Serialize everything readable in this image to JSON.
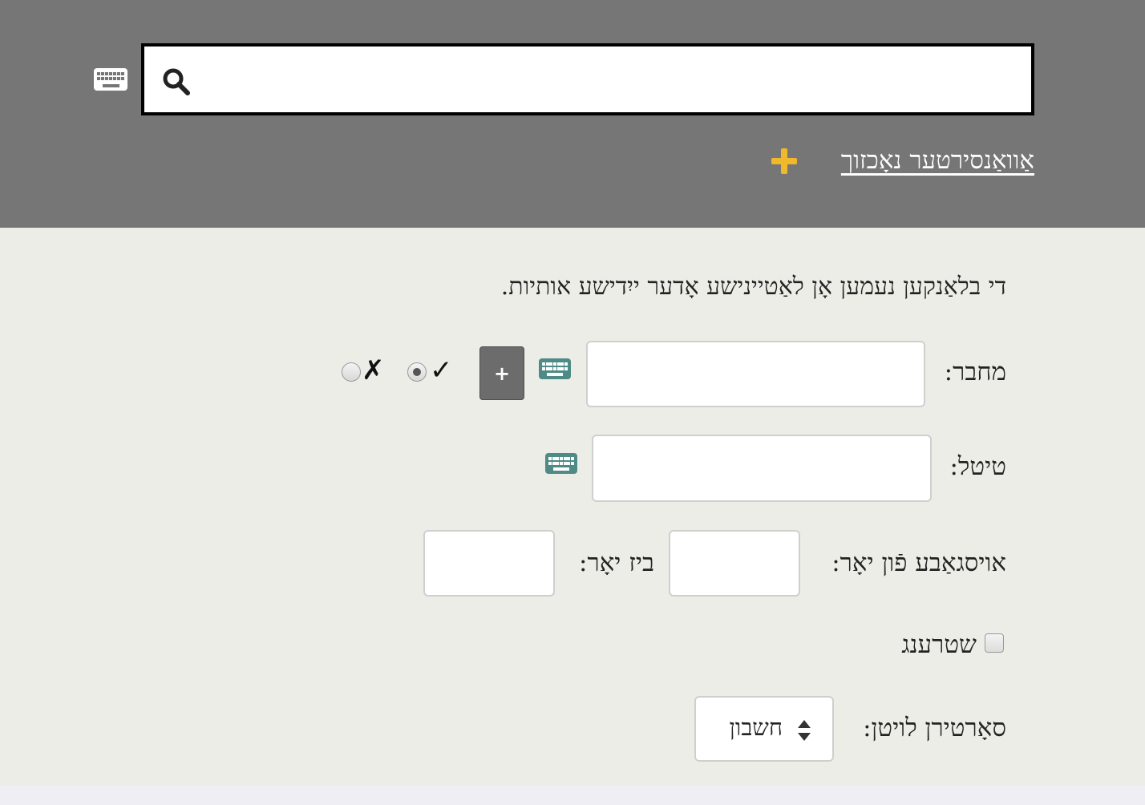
{
  "header": {
    "search_placeholder": "",
    "keyboard_icon": "keyboard-icon",
    "search_icon": "search-icon",
    "advanced_search_label": "אַוואַנסירטער נאָכזוך",
    "plus_icon": "plus-icon",
    "plus_color": "#f0b92c",
    "background": "#767676"
  },
  "form": {
    "instruction": "די בלאַנקען נעמען אָן לאַטיינישע אָדער ייִדישע אותיות.",
    "author_label": "מחבר:",
    "author_value": "",
    "add_author_label": "+",
    "include_mark": "✓",
    "exclude_mark": "✗",
    "include_selected": true,
    "title_label": "טיטל:",
    "title_value": "",
    "year_from_label": "אויסגאַבע פֿון יאָר:",
    "year_from_value": "",
    "year_to_label": "ביז יאָר:",
    "year_to_value": "",
    "strict_label": "שטרענג",
    "strict_checked": false,
    "sort_label": "סאָרטירן לויטן:",
    "sort_value": "חשבון",
    "accent_teal": "#4e8a86"
  }
}
